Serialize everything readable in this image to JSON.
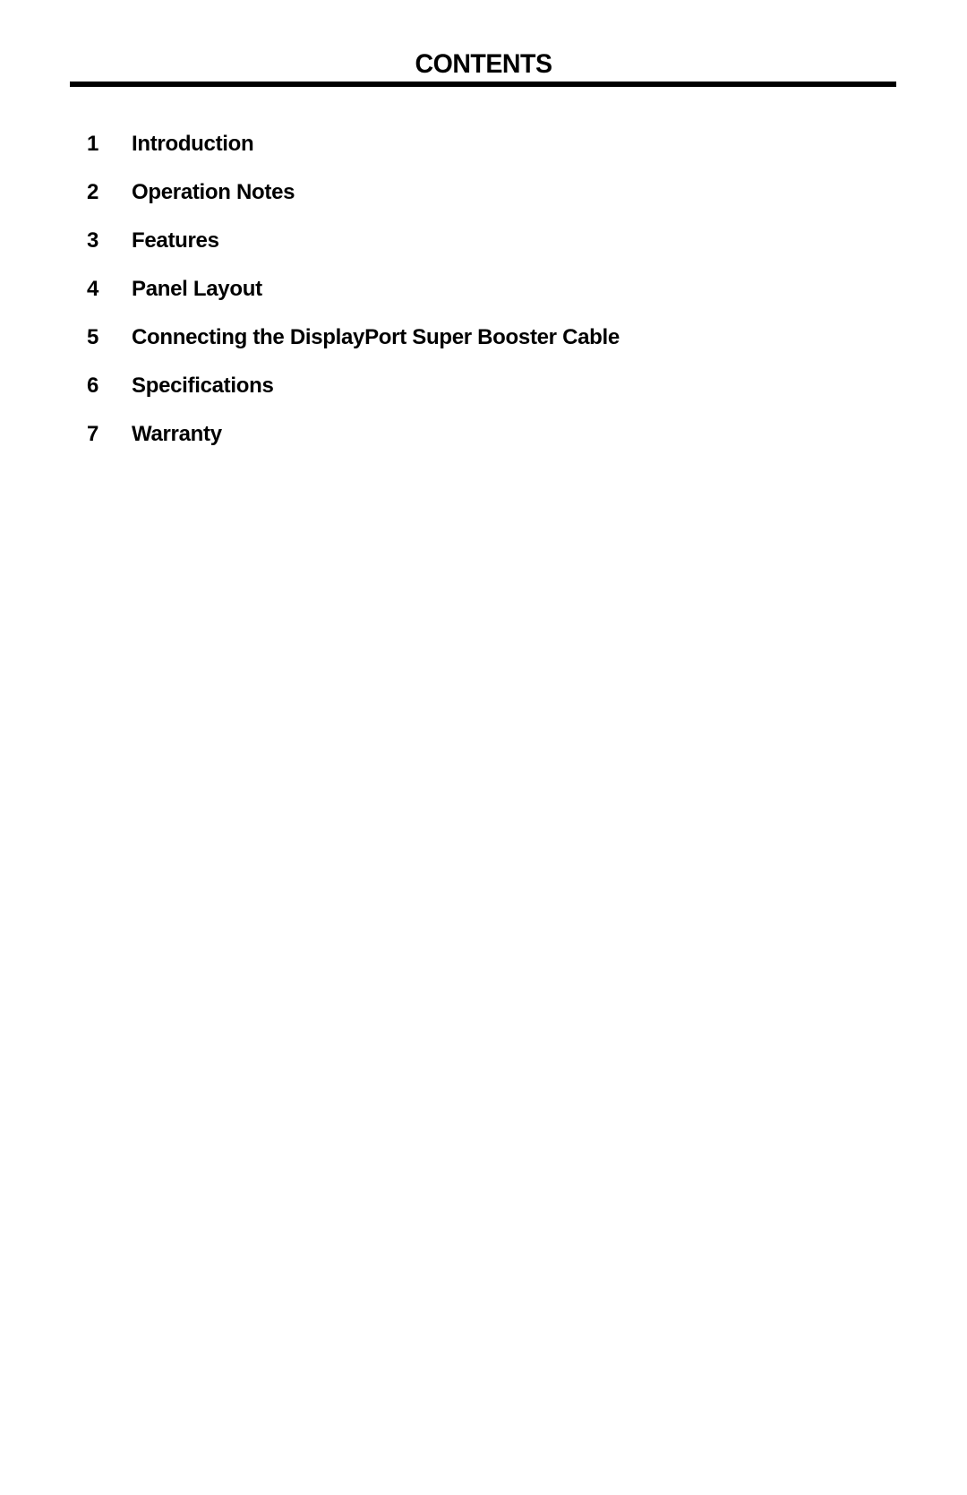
{
  "page": {
    "title": "CONTENTS"
  },
  "toc": {
    "items": [
      {
        "number": "1",
        "label": "Introduction"
      },
      {
        "number": "2",
        "label": "Operation Notes"
      },
      {
        "number": "3",
        "label": "Features"
      },
      {
        "number": "4",
        "label": "Panel Layout"
      },
      {
        "number": "5",
        "label": "Connecting the DisplayPort Super Booster Cable"
      },
      {
        "number": "6",
        "label": "Specifications"
      },
      {
        "number": "7",
        "label": "Warranty"
      }
    ]
  }
}
